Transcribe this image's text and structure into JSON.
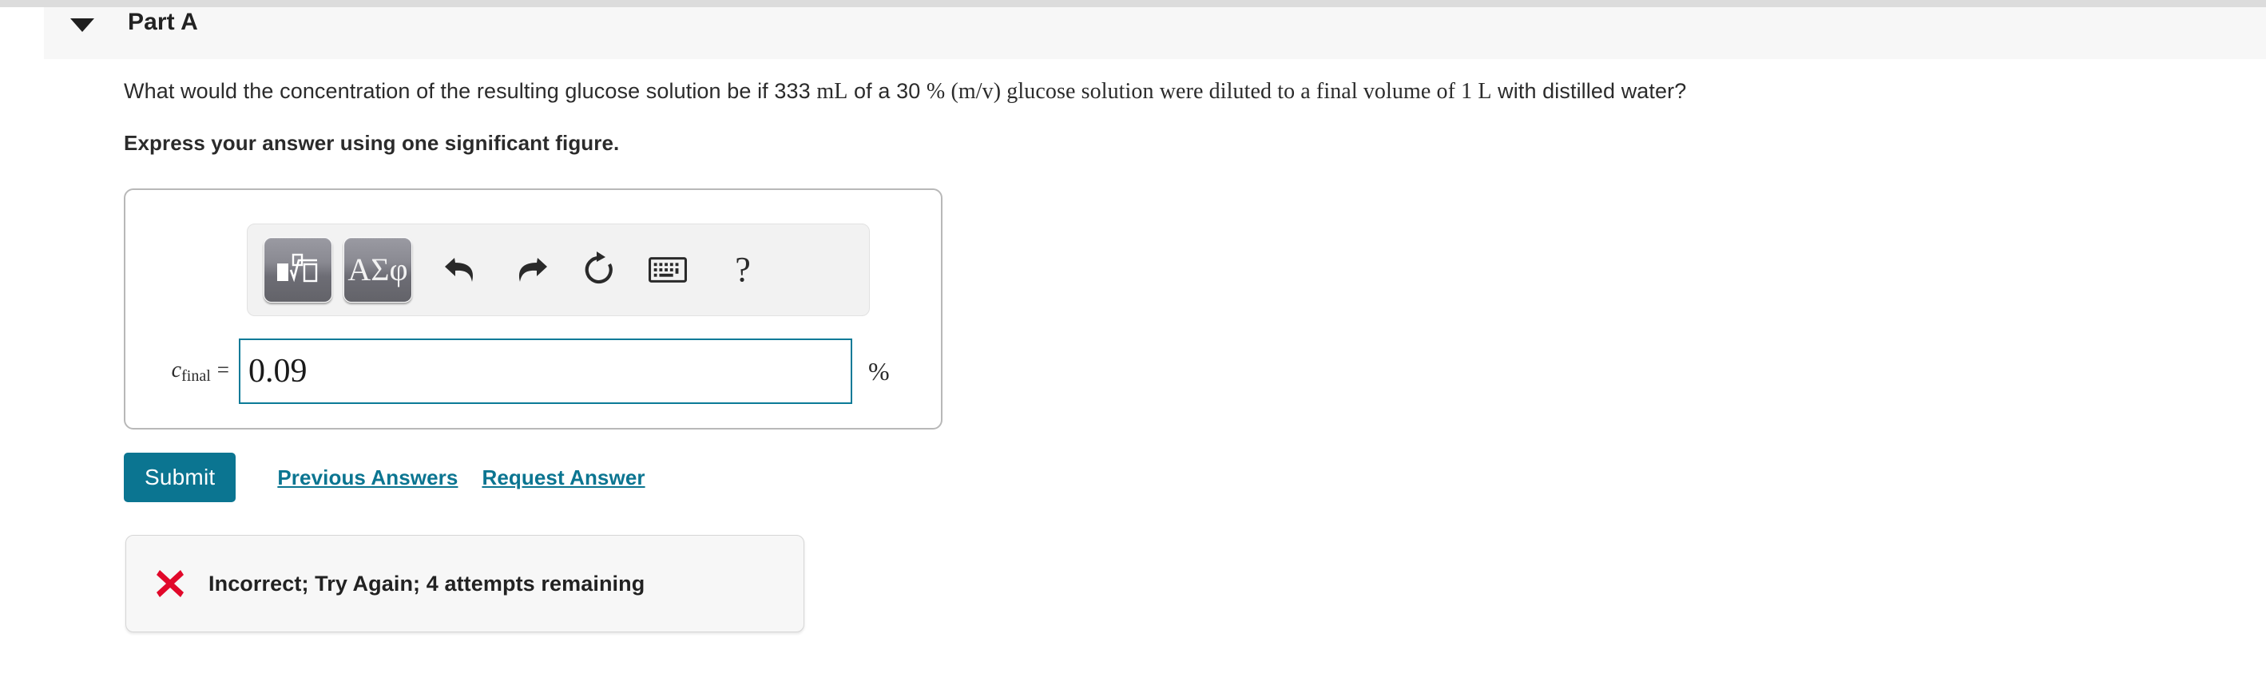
{
  "part": {
    "title": "Part A",
    "collapse_icon": "caret-down-icon"
  },
  "question": {
    "segment_1": "What would the concentration of the resulting glucose solution be if 333 ",
    "unit_ml": "mL",
    "segment_2": " of a 30 ",
    "percent_symbol": "%",
    "segment_3": " (m/v) glucose solution were diluted to a final volume of 1 ",
    "unit_l": "L",
    "segment_4": " with distilled water?",
    "instruction": "Express your answer using one significant figure."
  },
  "toolbar": {
    "template_button_label": "math-template",
    "greek_button_label": "ΑΣφ",
    "undo_label": "undo",
    "redo_label": "redo",
    "reset_label": "reset",
    "keyboard_label": "keyboard",
    "help_label": "?"
  },
  "answer": {
    "variable": "c",
    "subscript": "final",
    "equals": "=",
    "value": "0.09",
    "placeholder": "",
    "unit": "%",
    "border_color": "#0b7a97"
  },
  "actions": {
    "submit_label": "Submit",
    "previous_answers_label": "Previous Answers",
    "request_answer_label": "Request Answer",
    "accent_color": "#0b7591"
  },
  "feedback": {
    "icon": "x-mark-icon",
    "icon_color": "#e1082a",
    "message": "Incorrect; Try Again; 4 attempts remaining"
  }
}
